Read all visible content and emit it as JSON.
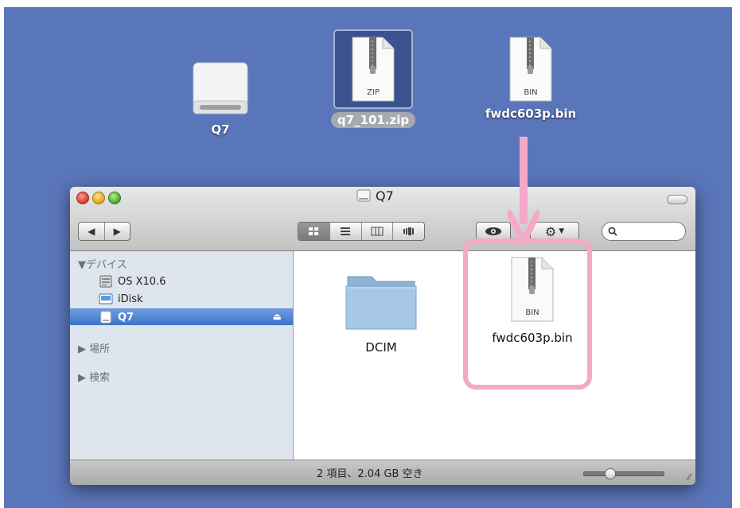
{
  "desktop": {
    "items": [
      {
        "label": "Q7",
        "icon": "drive-icon"
      },
      {
        "label": "q7_101.zip",
        "icon": "zip-file-icon",
        "badge": "ZIP",
        "selected": true
      },
      {
        "label": "fwdc603p.bin",
        "icon": "bin-file-icon",
        "badge": "BIN"
      }
    ]
  },
  "finder": {
    "title": "Q7",
    "sidebar": {
      "devices_header": "▼デバイス",
      "devices": [
        {
          "label": "OS X10.6",
          "icon": "hard-disk-icon"
        },
        {
          "label": "iDisk",
          "icon": "idisk-icon"
        },
        {
          "label": "Q7",
          "icon": "drive-icon",
          "selected": true
        }
      ],
      "places_header": "▶ 場所",
      "search_header": "▶ 検索"
    },
    "content": [
      {
        "label": "DCIM",
        "icon": "folder-icon"
      },
      {
        "label": "fwdc603p.bin",
        "icon": "bin-file-icon",
        "badge": "BIN"
      }
    ],
    "status": "2 項目、2.04 GB 空き",
    "search_placeholder": ""
  },
  "colors": {
    "desktop": "#5a76ba",
    "highlight": "#f5a9c9",
    "selection": "#3e73c9"
  }
}
